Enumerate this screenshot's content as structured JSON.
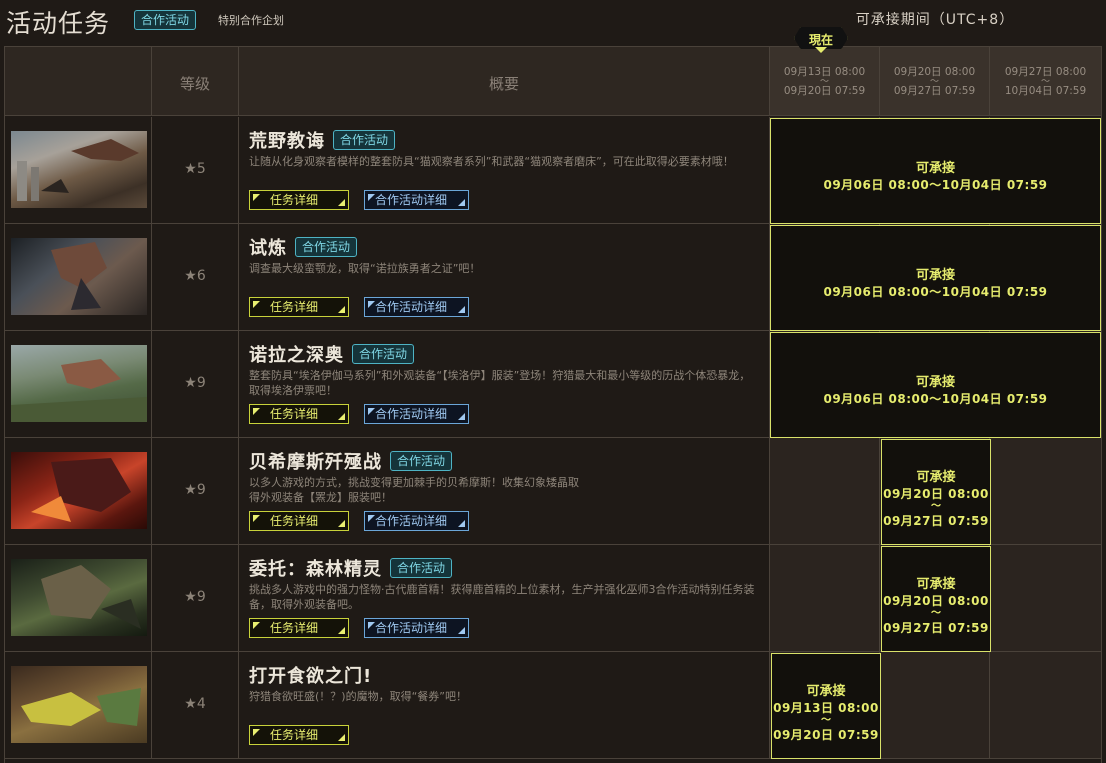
{
  "header": {
    "title": "活动任务",
    "badge": "合作活动",
    "subtitle": "特别合作企划",
    "period_heading": "可承接期间（UTC+8）",
    "now_label": "現在"
  },
  "columns": {
    "level": "等级",
    "summary": "概要",
    "dates": [
      {
        "start": "09月13日 08:00",
        "tilde": "～",
        "end": "09月20日 07:59"
      },
      {
        "start": "09月20日 08:00",
        "tilde": "～",
        "end": "09月27日 07:59"
      },
      {
        "start": "09月27日 08:00",
        "tilde": "～",
        "end": "10月04日 07:59"
      }
    ]
  },
  "buttons": {
    "detail": "任务详细",
    "collab_detail": "合作活动详细"
  },
  "quests": [
    {
      "name": "荒野教诲",
      "badge": "合作活动",
      "level": "★5",
      "desc": "让随从化身观察者模样的整套防具“猫观察者系列”和武器“猫观察者磨床”，可在此取得必要素材哦！",
      "avail": {
        "label": "可承接",
        "line": "09月06日 08:00～10月04日 07:59"
      }
    },
    {
      "name": "试炼",
      "badge": "合作活动",
      "level": "★6",
      "desc": "调查最大级蛮颚龙，取得“诺拉族勇者之证”吧！",
      "avail": {
        "label": "可承接",
        "line": "09月06日 08:00～10月04日 07:59"
      }
    },
    {
      "name": "诺拉之深奥",
      "badge": "合作活动",
      "level": "★9",
      "desc": "整套防具“埃洛伊伽马系列”和外观装备“【埃洛伊】服装”登场！狩猎最大和最小等级的历战个体恐暴龙，取得埃洛伊票吧！",
      "avail": {
        "label": "可承接",
        "line": "09月06日 08:00～10月04日 07:59"
      }
    },
    {
      "name": "贝希摩斯歼殛战",
      "badge": "合作活动",
      "level": "★9",
      "desc": "以多人游戏的方式，挑战变得更加棘手的贝希摩斯！收集幻象矮晶取得外观装备【罴龙】服装吧！",
      "avail": {
        "label": "可承接",
        "start": "09月20日 08:00",
        "tilde": "～",
        "end": "09月27日 07:59"
      }
    },
    {
      "name": "委托：森林精灵",
      "badge": "合作活动",
      "level": "★9",
      "desc": "挑战多人游戏中的强力怪物·古代鹿首精！获得鹿首精的上位素材，生产并强化巫师3合作活动特别任务装备，取得外观装备吧。",
      "avail": {
        "label": "可承接",
        "start": "09月20日 08:00",
        "tilde": "～",
        "end": "09月27日 07:59"
      }
    },
    {
      "name": "打开食欲之门!",
      "level": "★4",
      "desc": "狩猎食欲旺盛(！？)的魔物，取得“餐券”吧！",
      "avail": {
        "label": "可承接",
        "start": "09月13日 08:00",
        "tilde": "～",
        "end": "09月20日 07:59"
      }
    }
  ],
  "colors": {
    "accent_yellow": "#e6ec6e",
    "badge_cyan": "#7fd6e4",
    "button_blue": "#9fc8f0",
    "background": "#1f1a16"
  }
}
